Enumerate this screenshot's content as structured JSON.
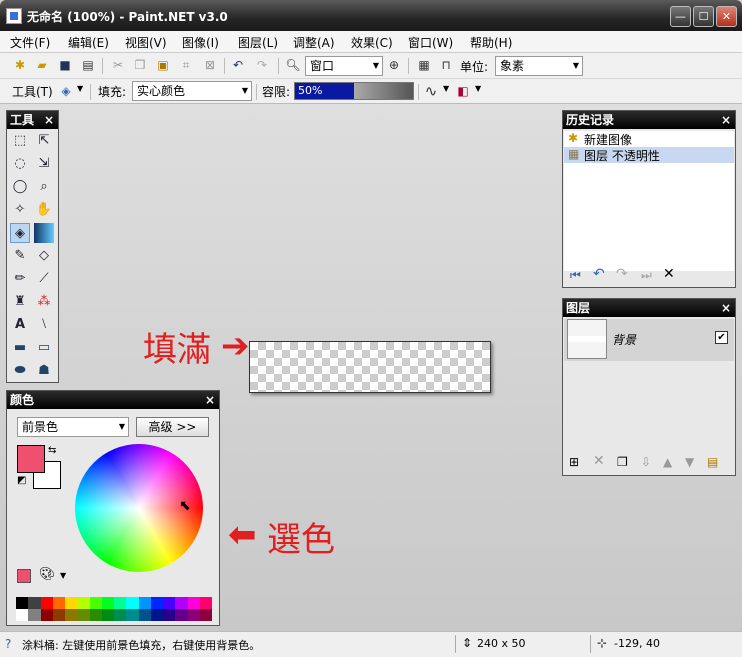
{
  "window": {
    "title": "无命名 (100%) - Paint.NET v3.0"
  },
  "menu": [
    "文件(F)",
    "编辑(E)",
    "视图(V)",
    "图像(I)",
    "图层(L)",
    "调整(A)",
    "效果(C)",
    "窗口(W)",
    "帮助(H)"
  ],
  "toolbar1": {
    "zoom_value": "窗口",
    "units_label": "单位:",
    "units_value": "象素"
  },
  "toolbar2": {
    "tool_label": "工具(T)",
    "fill_label": "填充:",
    "fill_value": "实心颜色",
    "tolerance_label": "容限:",
    "tolerance_value": "50%",
    "tolerance_fraction": 0.5
  },
  "tools_panel": {
    "title": "工具",
    "close": "×"
  },
  "history_panel": {
    "title": "历史记录",
    "close": "×",
    "items": [
      "新建图像",
      "图层 不透明性"
    ]
  },
  "layers_panel": {
    "title": "图层",
    "close": "×",
    "layer_name": "背景",
    "visible": true
  },
  "colors_panel": {
    "title": "颜色",
    "close": "×",
    "mode": "前景色",
    "advanced": "高级 >>",
    "primary": "#f05070",
    "secondary": "#ffffff"
  },
  "annotations": {
    "fill": "填滿",
    "pick": "選色"
  },
  "status": {
    "hint": "涂料桶: 左键使用前景色填充，右键使用背景色。",
    "size": "240 x 50",
    "coords": "-129, 40"
  },
  "palette": [
    "#000000",
    "#404040",
    "#ff0000",
    "#ff6a00",
    "#ffd800",
    "#b6ff00",
    "#4cff00",
    "#00ff21",
    "#00ff90",
    "#00ffff",
    "#0094ff",
    "#0026ff",
    "#4800ff",
    "#b200ff",
    "#ff00dc",
    "#ff006e"
  ]
}
